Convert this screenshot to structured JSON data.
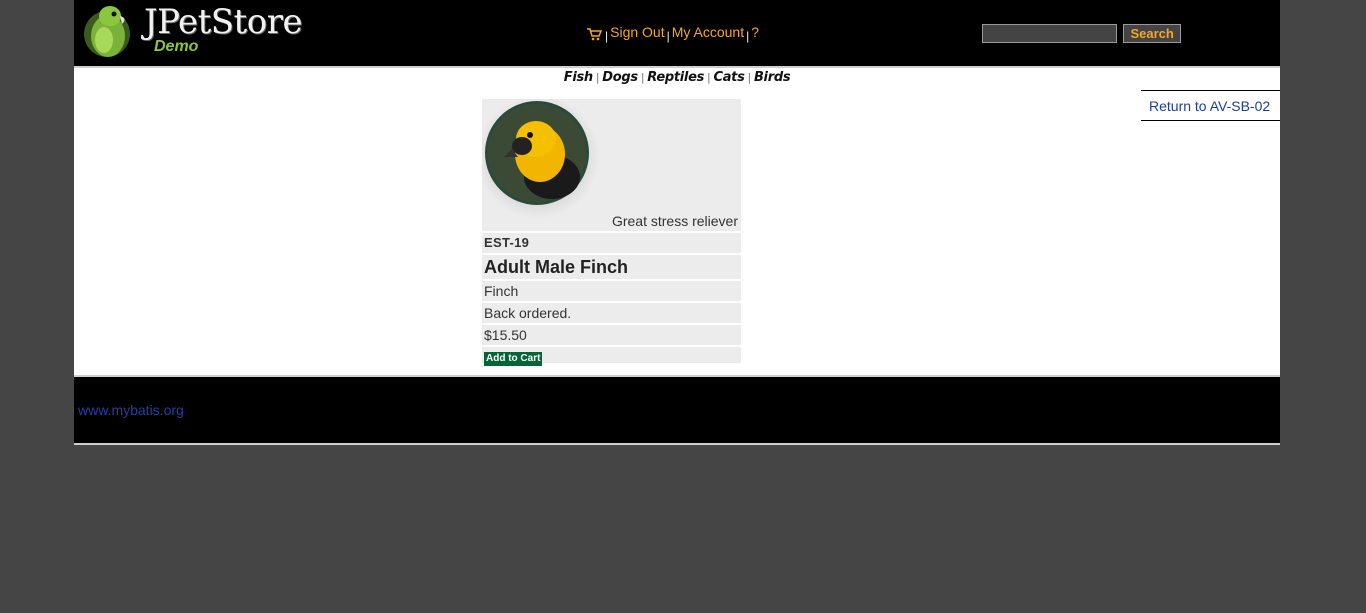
{
  "header": {
    "logo_title": "JPetStore",
    "logo_subtitle": "Demo",
    "menu": {
      "sign_out": "Sign Out",
      "my_account": "My Account",
      "help": "?",
      "separator": "|"
    },
    "search": {
      "value": "",
      "button_label": "Search"
    }
  },
  "quicklinks": [
    "Fish",
    "Dogs",
    "Reptiles",
    "Cats",
    "Birds"
  ],
  "sidebar": {
    "return_link": "Return to AV-SB-02"
  },
  "item": {
    "caption": "Great stress reliever",
    "id": "EST-19",
    "name": "Adult Male Finch",
    "description": "Finch",
    "stock": "Back ordered.",
    "price": "$15.50",
    "add_to_cart": "Add to Cart"
  },
  "footer": {
    "link": "www.mybatis.org"
  },
  "colors": {
    "accent": "#f5a623",
    "link": "#1f3f8f",
    "button": "#006633",
    "page_bg": "#454545"
  }
}
